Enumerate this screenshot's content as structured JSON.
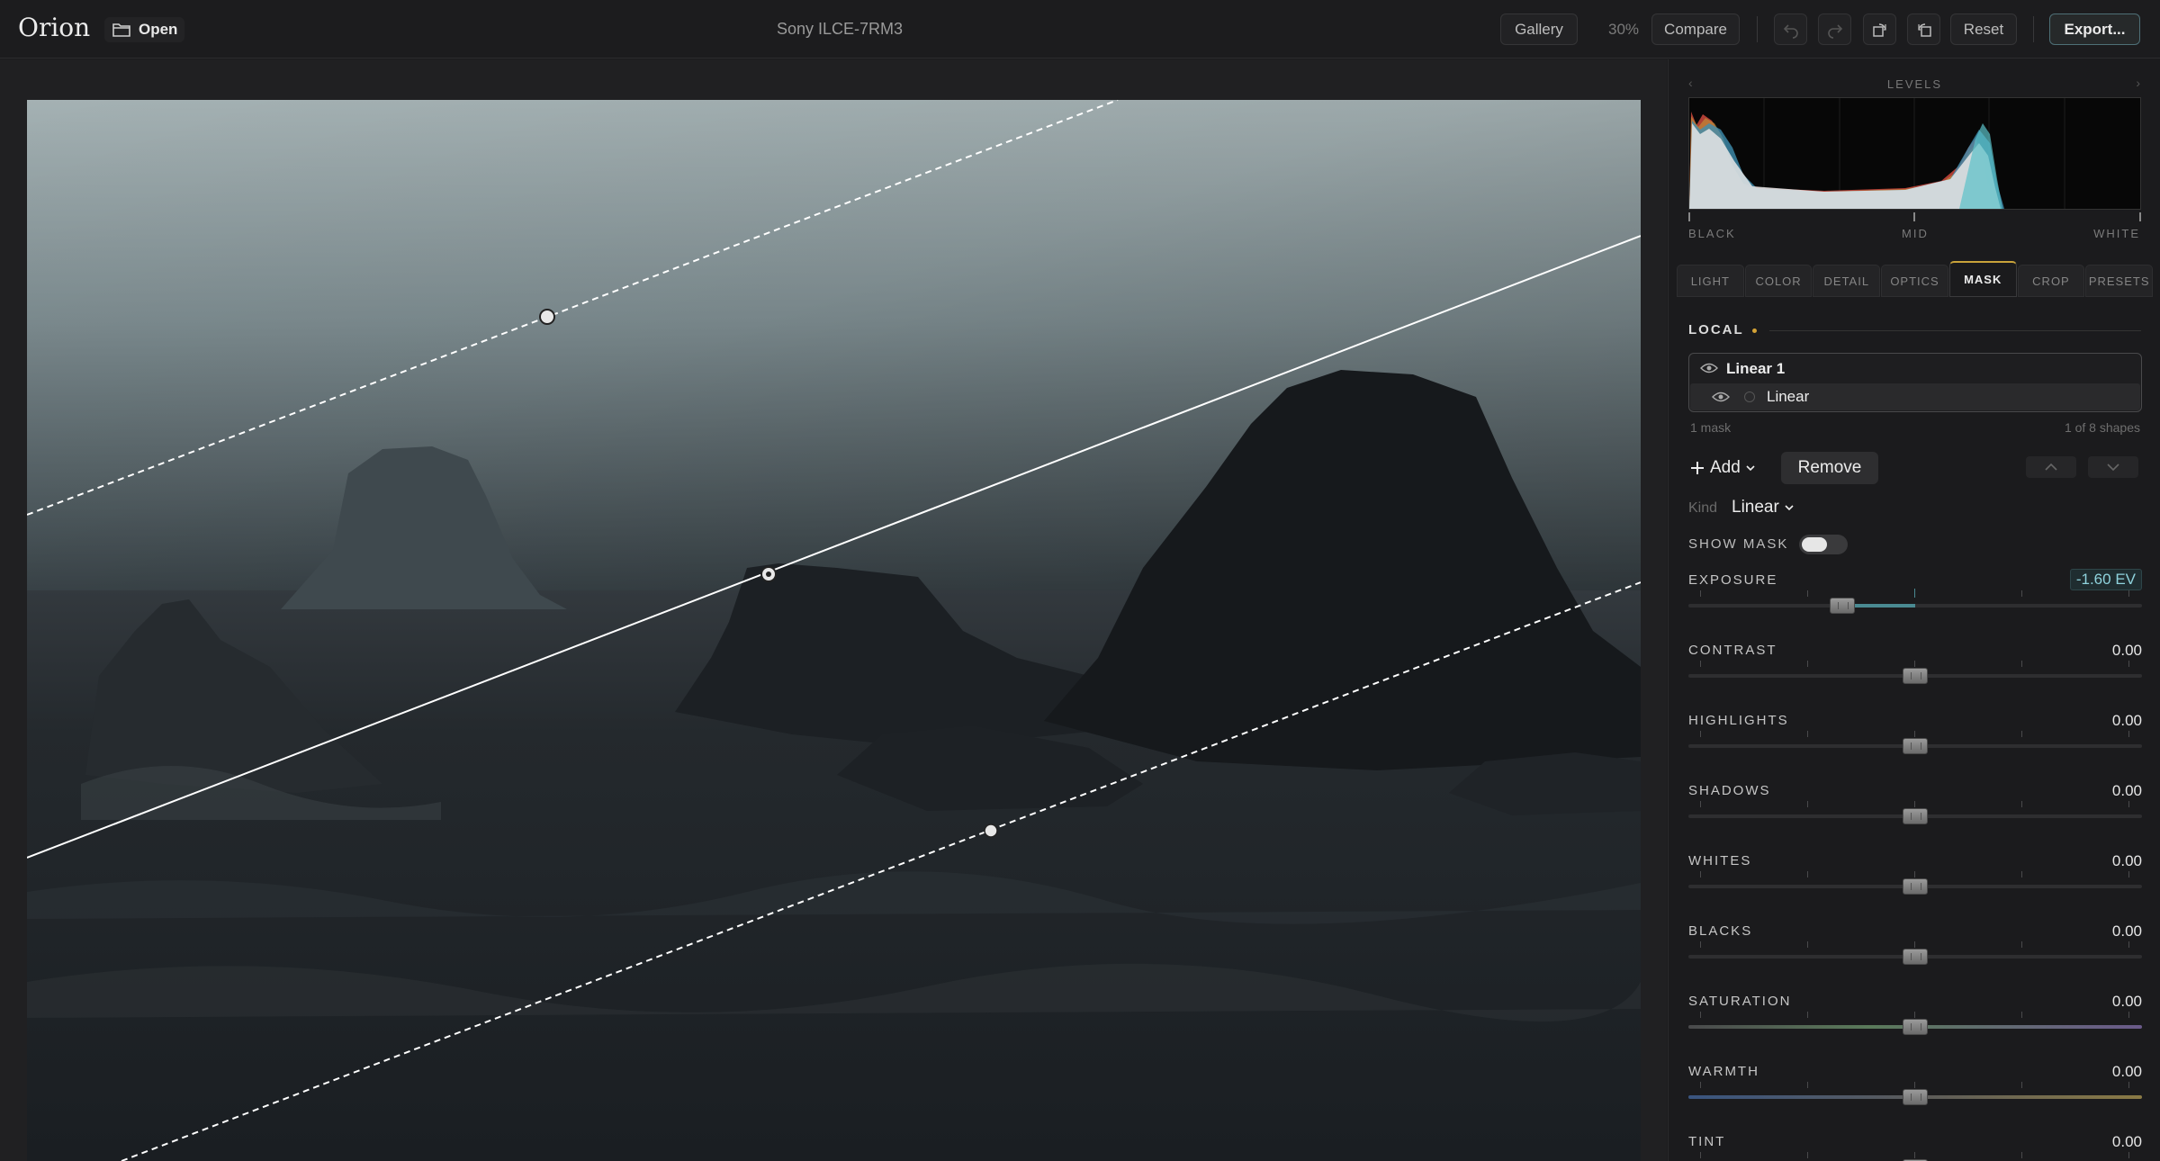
{
  "app": {
    "logo": "Orion",
    "camera": "Sony ILCE-7RM3"
  },
  "toolbar": {
    "open_label": "Open",
    "gallery_label": "Gallery",
    "zoom": "30%",
    "compare_label": "Compare",
    "reset_label": "Reset",
    "export_label": "Export..."
  },
  "levels": {
    "title": "LEVELS",
    "black": "BLACK",
    "mid": "MID",
    "white": "WHITE"
  },
  "tabs": [
    "LIGHT",
    "COLOR",
    "DETAIL",
    "OPTICS",
    "MASK",
    "CROP",
    "PRESETS"
  ],
  "active_tab": "MASK",
  "local": {
    "title": "LOCAL",
    "accent_color": "#d4a236",
    "mask_name": "Linear 1",
    "shape_name": "Linear",
    "mask_count": "1 mask",
    "shape_count": "1 of 8 shapes",
    "add_label": "Add",
    "remove_label": "Remove",
    "kind_label": "Kind",
    "kind_value": "Linear",
    "show_mask_label": "SHOW MASK",
    "show_mask_on": true
  },
  "adjustments": [
    {
      "label": "EXPOSURE",
      "value": "-1.60 EV",
      "level": -0.32,
      "track": "default"
    },
    {
      "label": "CONTRAST",
      "value": "0.00",
      "level": 0,
      "track": "default"
    },
    {
      "label": "HIGHLIGHTS",
      "value": "0.00",
      "level": 0,
      "track": "default"
    },
    {
      "label": "SHADOWS",
      "value": "0.00",
      "level": 0,
      "track": "default"
    },
    {
      "label": "WHITES",
      "value": "0.00",
      "level": 0,
      "track": "default"
    },
    {
      "label": "BLACKS",
      "value": "0.00",
      "level": 0,
      "track": "default"
    },
    {
      "label": "SATURATION",
      "value": "0.00",
      "level": 0,
      "track": "saturation"
    },
    {
      "label": "WARMTH",
      "value": "0.00",
      "level": 0,
      "track": "warmth"
    },
    {
      "label": "TINT",
      "value": "0.00",
      "level": 0,
      "track": "default"
    }
  ],
  "colors": {
    "accent": "#4a8a92",
    "export_border": "#4e6f76",
    "tab_indicator": "#c9a33a"
  }
}
